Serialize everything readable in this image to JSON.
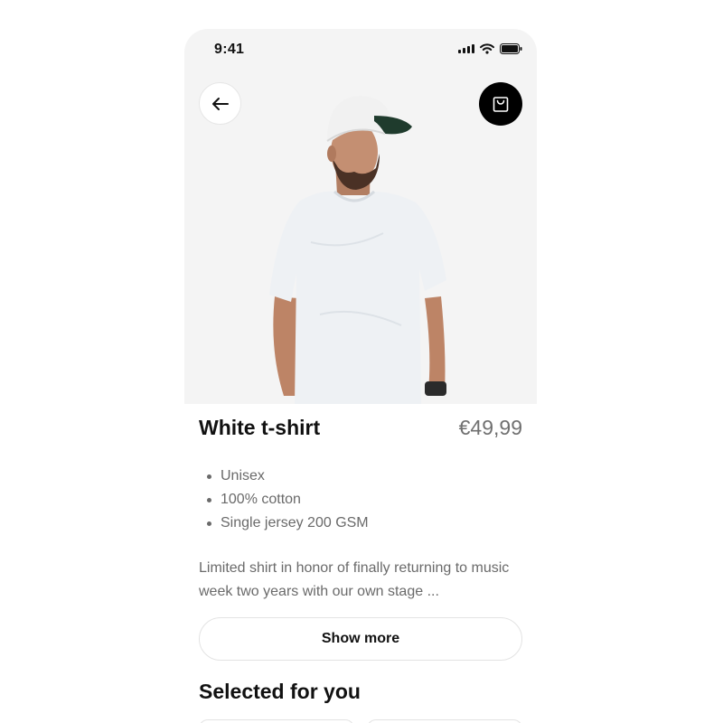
{
  "status_bar": {
    "time": "9:41",
    "icons": [
      "signal-icon",
      "wifi-icon",
      "battery-icon"
    ]
  },
  "header": {
    "back_icon": "arrow-left-icon",
    "bag_icon": "shopping-bag-icon"
  },
  "product": {
    "name": "White t-shirt",
    "price": "€49,99",
    "features": [
      "Unisex",
      "100% cotton",
      "Single jersey 200 GSM"
    ],
    "description": "Limited shirt in honor of finally returning to music week two years with our own stage ...",
    "show_more_label": "Show more"
  },
  "recommendations": {
    "title": "Selected for you",
    "visible_cards": 2
  },
  "colors": {
    "hero_bg": "#f4f4f4",
    "accent": "#000000",
    "muted_text": "#6a6a6a",
    "price": "#707070"
  }
}
